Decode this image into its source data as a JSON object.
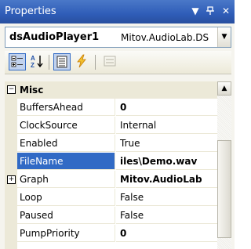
{
  "window": {
    "title": "Properties"
  },
  "title_buttons": {
    "dropdown": "▼",
    "pin": "ᵖ",
    "close": "✕"
  },
  "object_selector": {
    "name": "dsAudioPlayer1",
    "type": "Mitov.AudioLab.DS",
    "dropdown_glyph": "▼"
  },
  "toolbar": {
    "buttons": [
      {
        "name": "categorized",
        "icon": "categorized-icon",
        "active": true
      },
      {
        "name": "alphabetical",
        "icon": "alphabetical-sort-icon",
        "active": false
      },
      {
        "name": "properties",
        "icon": "properties-icon",
        "active": true
      },
      {
        "name": "events",
        "icon": "lightning-icon",
        "active": false
      },
      {
        "name": "property-pages",
        "icon": "property-pages-icon",
        "active": false
      }
    ]
  },
  "grid": {
    "category": {
      "label": "Misc",
      "expander": "⊟"
    },
    "rows": [
      {
        "name": "BuffersAhead",
        "value": "0",
        "bold": true
      },
      {
        "name": "ClockSource",
        "value": "Internal",
        "bold": false
      },
      {
        "name": "Enabled",
        "value": "True",
        "bold": false
      },
      {
        "name": "FileName",
        "value": "iles\\Demo.wav",
        "bold": true,
        "selected": true
      },
      {
        "name": "Graph",
        "value": "Mitov.AudioLab",
        "bold": true,
        "expander": "+"
      },
      {
        "name": "Loop",
        "value": "False",
        "bold": false
      },
      {
        "name": "Paused",
        "value": "False",
        "bold": false
      },
      {
        "name": "PumpPriority",
        "value": "0",
        "bold": true
      }
    ]
  },
  "scrollbar": {
    "up_glyph": "▲"
  },
  "colors": {
    "titlebar": "#2f5db8",
    "selection": "#316ac5",
    "panel": "#ece9d8"
  }
}
